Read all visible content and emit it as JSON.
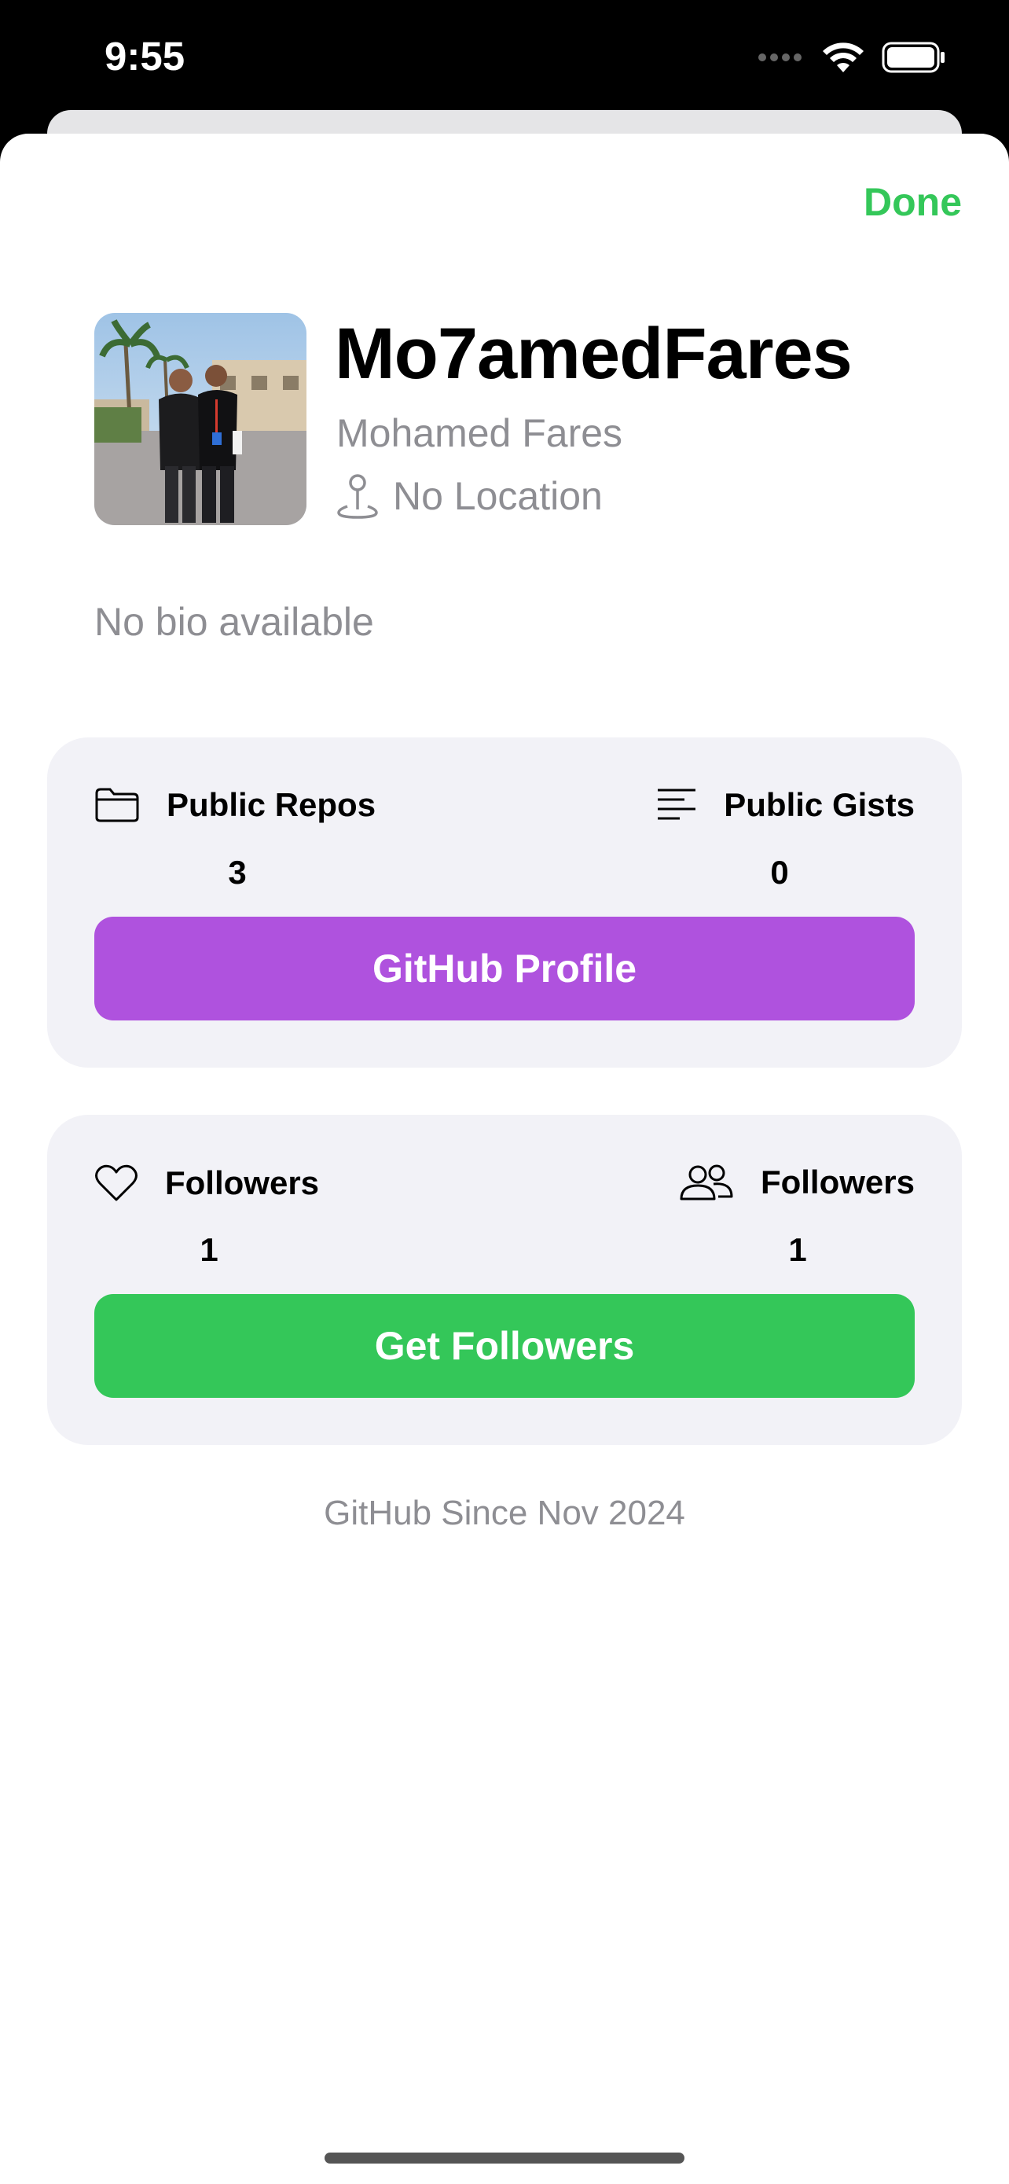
{
  "status_bar": {
    "time": "9:55"
  },
  "sheet": {
    "done_label": "Done"
  },
  "profile": {
    "username": "Mo7amedFares",
    "full_name": "Mohamed Fares",
    "location": "No Location",
    "bio": "No bio available"
  },
  "repos_card": {
    "left_label": "Public Repos",
    "left_value": "3",
    "right_label": "Public Gists",
    "right_value": "0",
    "button_label": "GitHub Profile",
    "button_color": "#af52de"
  },
  "followers_card": {
    "left_label": "Followers",
    "left_value": "1",
    "right_label": "Followers",
    "right_value": "1",
    "button_label": "Get Followers",
    "button_color": "#34c759"
  },
  "footer": {
    "since": "GitHub Since Nov 2024"
  },
  "colors": {
    "accent_green": "#34c759",
    "accent_purple": "#af52de",
    "secondary_text": "#8e8e93"
  }
}
